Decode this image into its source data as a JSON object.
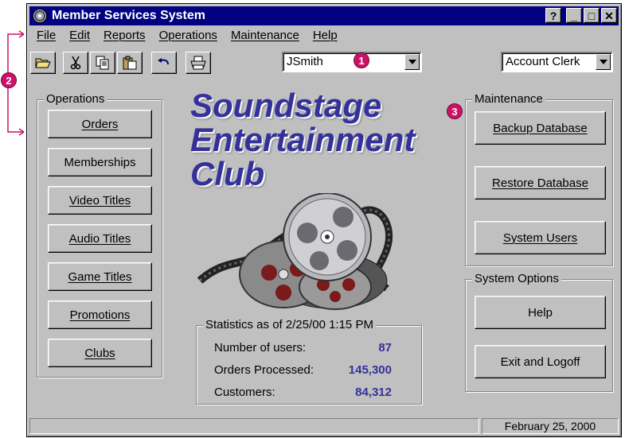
{
  "window": {
    "title": "Member Services System"
  },
  "titlebar_buttons": {
    "help": "?",
    "minimize": "_",
    "maximize": "□",
    "close": "✕"
  },
  "menu": [
    {
      "label": "File"
    },
    {
      "label": "Edit"
    },
    {
      "label": "Reports"
    },
    {
      "label": "Operations"
    },
    {
      "label": "Maintenance"
    },
    {
      "label": "Help"
    }
  ],
  "toolbar": {
    "icons": [
      "open-folder-icon",
      "cut-icon",
      "copy-icon",
      "paste-icon",
      "undo-icon",
      "print-icon"
    ],
    "user_combo_value": "JSmith",
    "role_combo_value": "Account Clerk"
  },
  "callouts": {
    "one": "1",
    "two": "2",
    "three": "3"
  },
  "operations": {
    "label": "Operations",
    "buttons": [
      {
        "label": "Orders"
      },
      {
        "label": "Memberships"
      },
      {
        "label": "Video Titles"
      },
      {
        "label": "Audio Titles"
      },
      {
        "label": "Game Titles"
      },
      {
        "label": "Promotions"
      },
      {
        "label": "Clubs"
      }
    ]
  },
  "brand": {
    "line1": "Soundstage",
    "line2": "Entertainment",
    "line3": "Club"
  },
  "stats": {
    "label": "Statistics as of 2/25/00 1:15 PM",
    "rows": [
      {
        "label": "Number of users:",
        "value": "87"
      },
      {
        "label": "Orders Processed:",
        "value": "145,300"
      },
      {
        "label": "Customers:",
        "value": "84,312"
      }
    ]
  },
  "maintenance": {
    "label": "Maintenance",
    "buttons": [
      {
        "label": "Backup Database"
      },
      {
        "label": "Restore Database"
      },
      {
        "label": "System Users"
      }
    ]
  },
  "system_options": {
    "label": "System Options",
    "buttons": [
      {
        "label": "Help"
      },
      {
        "label": "Exit and Logoff"
      }
    ]
  },
  "statusbar": {
    "left": "",
    "date": "February 25, 2000"
  },
  "colors": {
    "titlebar": "#000080",
    "brand": "#34319a",
    "callout": "#cc1166",
    "face": "#c0c0c0"
  }
}
